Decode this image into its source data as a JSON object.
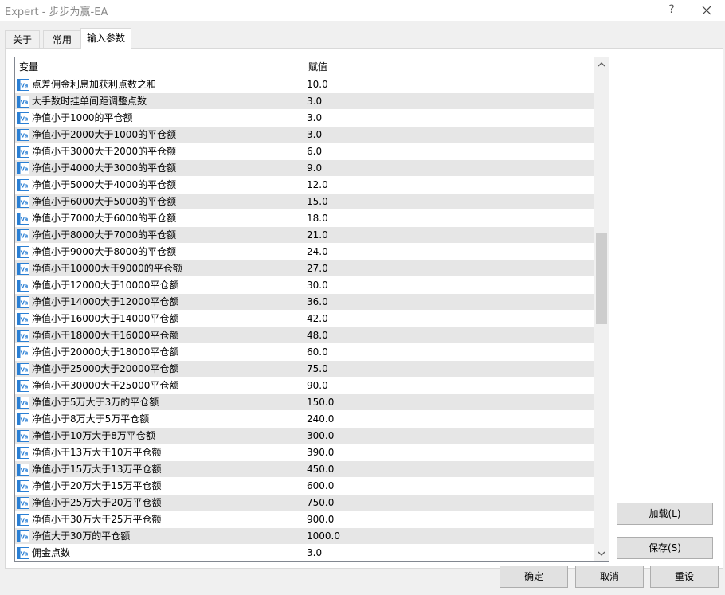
{
  "window": {
    "title": "Expert - 步步为赢-EA",
    "help_label": "?"
  },
  "tabs": [
    {
      "label": "关于"
    },
    {
      "label": "常用"
    },
    {
      "label": "输入参数",
      "active": true
    }
  ],
  "grid": {
    "columns": {
      "variable": "变量",
      "value": "赋值"
    },
    "rows": [
      {
        "name": "点差佣金利息加获利点数之和",
        "value": "10.0"
      },
      {
        "name": "大手数时挂单间距调整点数",
        "value": "3.0"
      },
      {
        "name": "净值小于1000的平仓额",
        "value": "3.0"
      },
      {
        "name": "净值小于2000大于1000的平仓额",
        "value": "3.0"
      },
      {
        "name": "净值小于3000大于2000的平仓额",
        "value": "6.0"
      },
      {
        "name": "净值小于4000大于3000的平仓额",
        "value": "9.0"
      },
      {
        "name": "净值小于5000大于4000的平仓额",
        "value": "12.0"
      },
      {
        "name": "净值小于6000大于5000的平仓额",
        "value": "15.0"
      },
      {
        "name": "净值小于7000大于6000的平仓额",
        "value": "18.0"
      },
      {
        "name": "净值小于8000大于7000的平仓额",
        "value": "21.0"
      },
      {
        "name": "净值小于9000大于8000的平仓额",
        "value": "24.0"
      },
      {
        "name": "净值小于10000大于9000的平仓额",
        "value": "27.0"
      },
      {
        "name": "净值小于12000大于10000平仓额",
        "value": "30.0"
      },
      {
        "name": "净值小于14000大于12000平仓额",
        "value": "36.0"
      },
      {
        "name": "净值小于16000大于14000平仓额",
        "value": "42.0"
      },
      {
        "name": "净值小于18000大于16000平仓额",
        "value": "48.0"
      },
      {
        "name": "净值小于20000大于18000平仓额",
        "value": "60.0"
      },
      {
        "name": "净值小于25000大于20000平仓额",
        "value": "75.0"
      },
      {
        "name": "净值小于30000大于25000平仓额",
        "value": "90.0"
      },
      {
        "name": "净值小于5万大于3万的平仓额",
        "value": "150.0"
      },
      {
        "name": "净值小于8万大于5万平仓额",
        "value": "240.0"
      },
      {
        "name": "净值小于10万大于8万平仓额",
        "value": "300.0"
      },
      {
        "name": "净值小于13万大于10万平仓额",
        "value": "390.0"
      },
      {
        "name": "净值小于15万大于13万平仓额",
        "value": "450.0"
      },
      {
        "name": "净值小于20万大于15万平仓额",
        "value": "600.0"
      },
      {
        "name": "净值小于25万大于20万平仓额",
        "value": "750.0"
      },
      {
        "name": "净值小于30万大于25万平仓额",
        "value": "900.0"
      },
      {
        "name": "净值大于30万的平仓额",
        "value": "1000.0"
      },
      {
        "name": "佣金点数",
        "value": "3.0"
      }
    ],
    "row_icon": "variable-icon"
  },
  "side_buttons": {
    "load": "加载(L)",
    "save": "保存(S)"
  },
  "footer_buttons": {
    "ok": "确定",
    "cancel": "取消",
    "reset": "重设"
  },
  "colors": {
    "alt_row": "#e6e6e6",
    "icon_blue": "#2a7fd4"
  }
}
